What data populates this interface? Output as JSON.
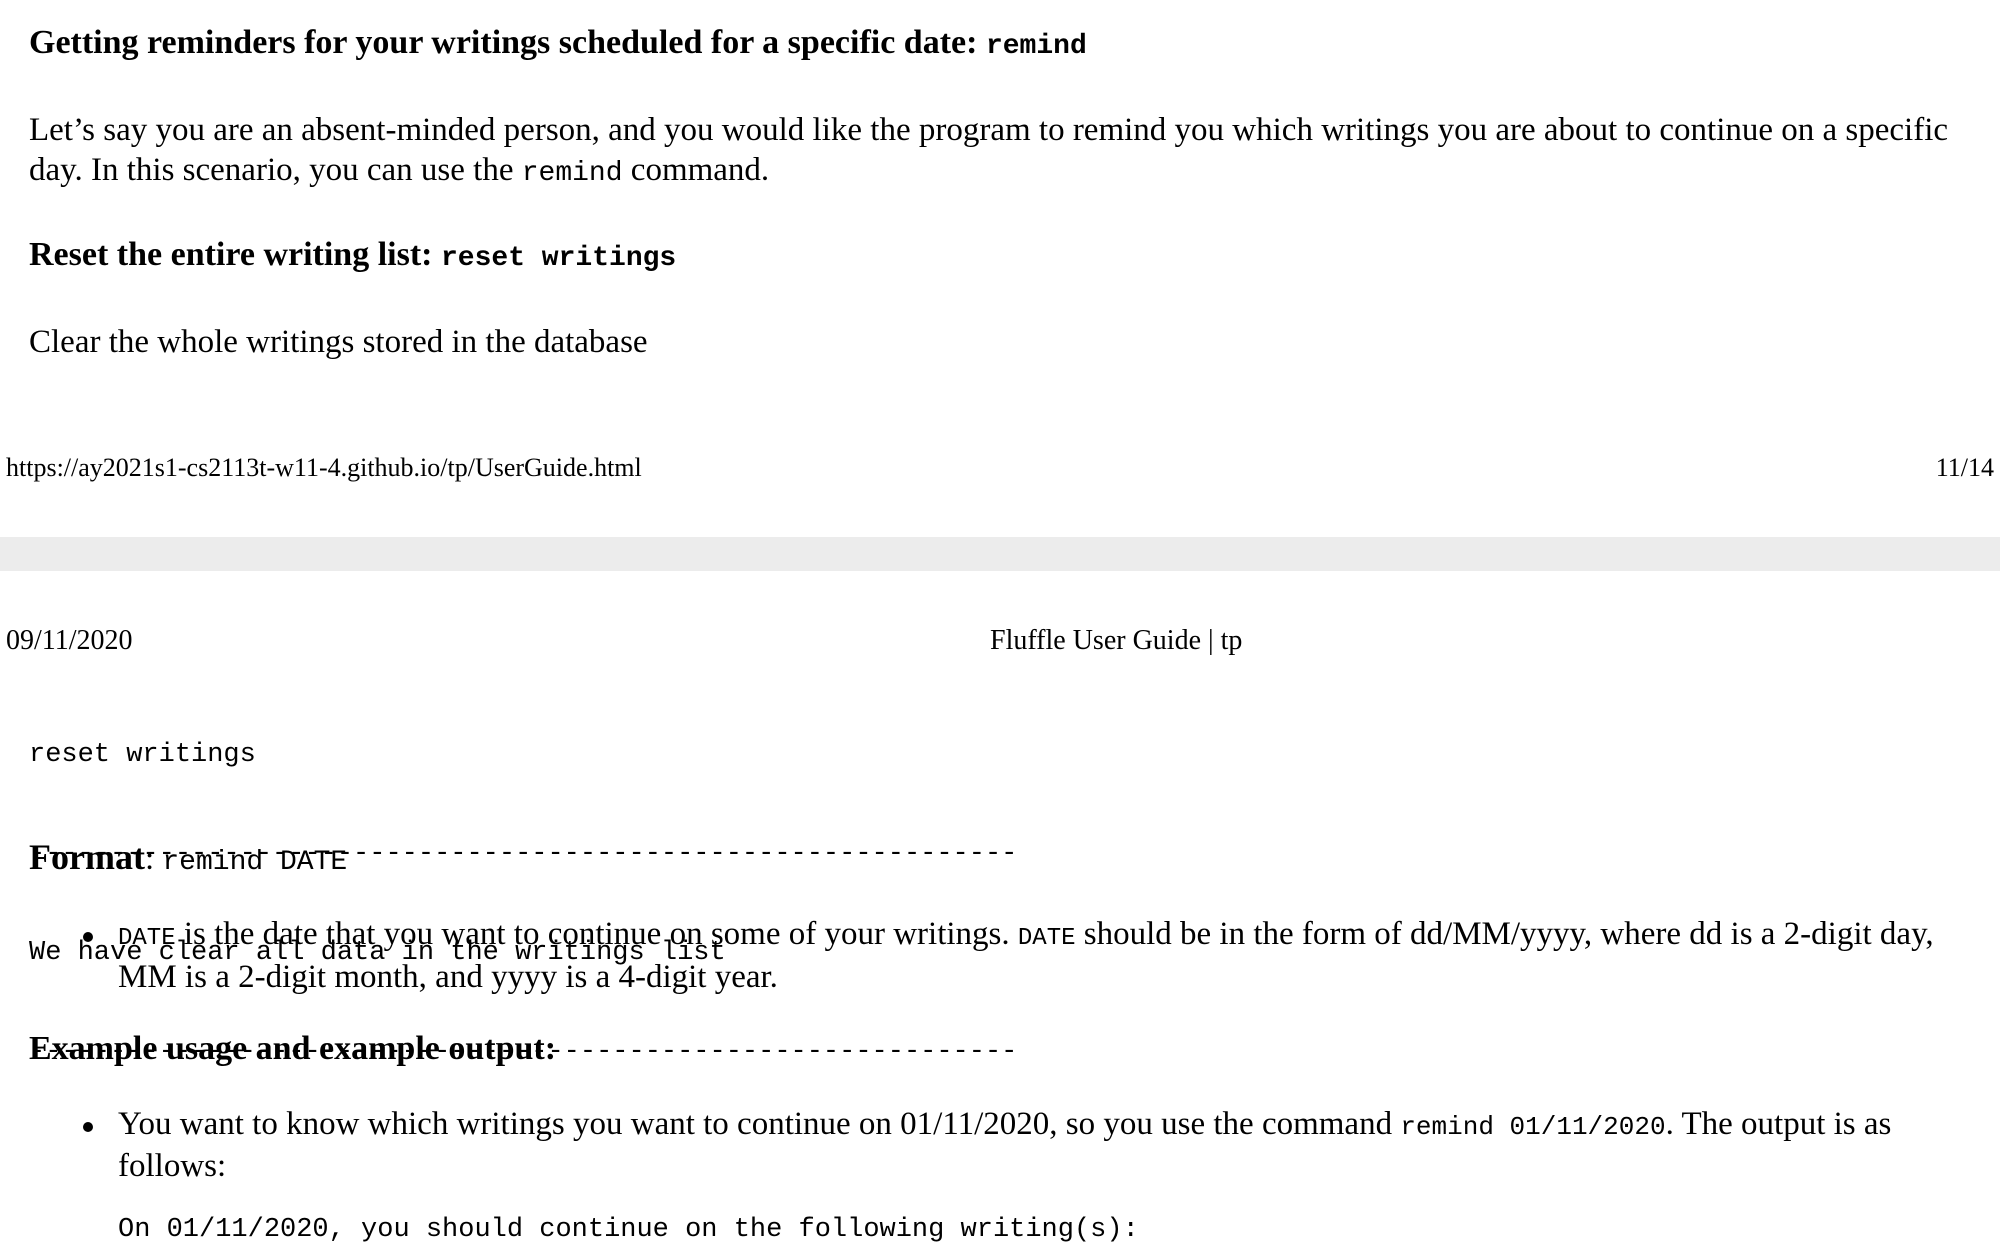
{
  "page1": {
    "heading1": {
      "text": "Getting reminders for your writings scheduled for a specific date: ",
      "code": "remind"
    },
    "para1": {
      "before": "Let’s say you are an absent-minded person, and you would like the program to remind you which writings you are about to continue on a specific day. In this scenario, you can use the ",
      "code": "remind",
      "after": " command."
    },
    "heading2": {
      "text": "Reset the entire writing list: ",
      "code": "reset writings"
    },
    "para2": "Clear the whole writings stored in the database",
    "footer": {
      "url": "https://ay2021s1-cs2113t-w11-4.github.io/tp/UserGuide.html",
      "page": "11/14"
    }
  },
  "page2": {
    "header": {
      "date": "09/11/2020",
      "title": "Fluffle User Guide | tp"
    },
    "code_block": {
      "line1": "reset writings",
      "separator1": "-------------------------------------------------------------",
      "line2": "We have clear all data in the writings list",
      "separator2": "-------------------------------------------------------------"
    },
    "format": {
      "label": "Format",
      "colon": ": ",
      "code": "remind DATE"
    },
    "bullet1": {
      "code1": "DATE",
      "text1": " is the date that you want to continue on some of your writings. ",
      "code2": "DATE",
      "text2": " should be in the form of dd/MM/yyyy, where dd is a 2-digit day, MM is a 2-digit month, and yyyy is a 4-digit year."
    },
    "example_heading": "Example usage and example output:",
    "bullet2": {
      "before": "You want to know which writings you want to continue on 01/11/2020, so you use the command ",
      "code": "remind 01/11/2020",
      "after": ". The output is as follows:"
    },
    "output_line": "On 01/11/2020, you should continue on the following writing(s):"
  }
}
